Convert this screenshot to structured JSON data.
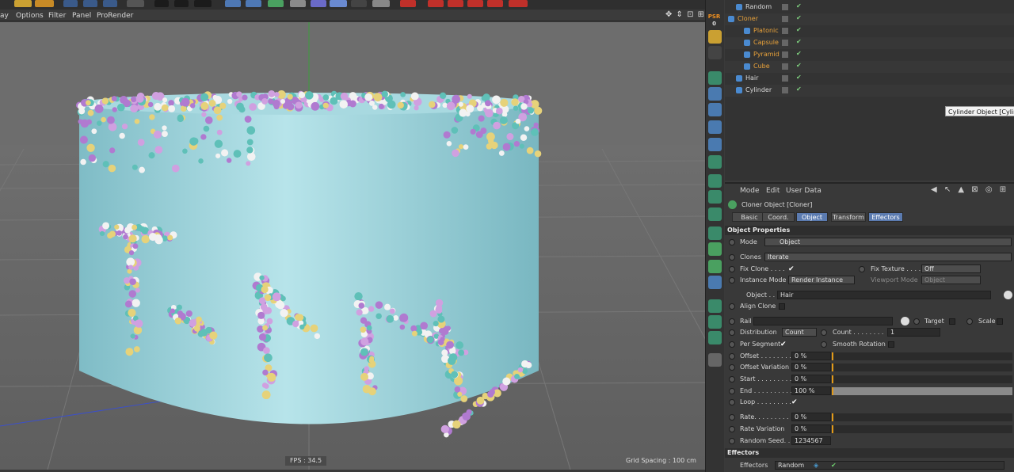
{
  "viewport_menu": [
    "ay",
    "Options",
    "Filter",
    "Panel",
    "ProRender"
  ],
  "viewport": {
    "fps": "FPS : 34.5",
    "grid_spacing": "Grid Spacing : 100 cm",
    "nav": "✥ ⇕ ⊡ ⊞"
  },
  "psr": {
    "label": "PSR",
    "value": "0"
  },
  "object_manager": {
    "objects": [
      {
        "name": "Random",
        "indent": 1,
        "color": "#d8d8d8"
      },
      {
        "name": "Cloner",
        "indent": 0,
        "color": "#e9a23a"
      },
      {
        "name": "Platonic",
        "indent": 2,
        "color": "#e9a23a"
      },
      {
        "name": "Capsule",
        "indent": 2,
        "color": "#e9a23a"
      },
      {
        "name": "Pyramid",
        "indent": 2,
        "color": "#e9a23a"
      },
      {
        "name": "Cube",
        "indent": 2,
        "color": "#e9a23a"
      },
      {
        "name": "Hair",
        "indent": 1,
        "color": "#d8d8d8"
      },
      {
        "name": "Cylinder",
        "indent": 1,
        "color": "#d8d8d8"
      }
    ],
    "tooltip": "Cylinder Object [Cylinder]"
  },
  "attributes": {
    "menu": [
      "Mode",
      "Edit",
      "User Data"
    ],
    "title": "Cloner Object [Cloner]",
    "tabs": [
      "Basic",
      "Coord.",
      "Object",
      "Transform",
      "Effectors"
    ],
    "section_object": "Object Properties",
    "mode_label": "Mode",
    "mode_value": "Object",
    "clones_label": "Clones",
    "clones_value": "Iterate",
    "fix_clone": "Fix Clone . . . .",
    "fix_texture": "Fix Texture . . . .",
    "fix_texture_value": "Off",
    "instance_mode": "Instance Mode",
    "instance_mode_value": "Render Instance",
    "viewport_mode": "Viewport Mode",
    "viewport_mode_value": "Object",
    "object_label": "Object . .",
    "object_value": "Hair",
    "align_clone": "Align Clone",
    "rail": "Rail",
    "target": "Target",
    "scale": "Scale",
    "distribution": "Distribution",
    "distribution_value": "Count",
    "count_label": "Count . . . . . . . .",
    "count_value": "1",
    "per_segment": "Per Segment",
    "smooth_rotation": "Smooth Rotation",
    "sliders": [
      {
        "label": "Offset . . . . . . . .",
        "value": "0 %",
        "fill": 0
      },
      {
        "label": "Offset Variation",
        "value": "0 %",
        "fill": 0
      },
      {
        "label": "Start . . . . . . . . .",
        "value": "0 %",
        "fill": 0
      },
      {
        "label": "End . . . . . . . . . .",
        "value": "100 %",
        "fill": 1
      },
      {
        "label": "Rate. . . . . . . . . .",
        "value": "0 %",
        "fill": 0
      },
      {
        "label": "Rate Variation",
        "value": "0 %",
        "fill": 0
      }
    ],
    "loop": "Loop . . . . . . . . .",
    "random_seed": "Random Seed. .",
    "random_seed_value": "1234567",
    "section_effectors": "Effectors",
    "effectors_label": "Effectors",
    "effectors_value": "Random"
  },
  "colors": {
    "accent": "#5b7bb0",
    "orange": "#e9a23a",
    "cylinder": "#8fd0d8"
  }
}
